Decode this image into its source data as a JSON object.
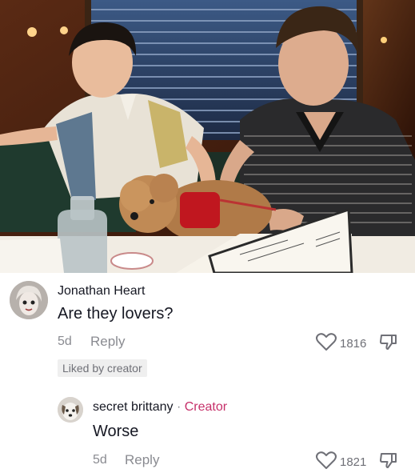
{
  "post": {
    "image_icon": "photo-two-men-with-dog-at-restaurant"
  },
  "comments": [
    {
      "username": "Jonathan Heart",
      "text": "Are they lovers?",
      "age": "5d",
      "reply_label": "Reply",
      "likes": "1816",
      "liked_by_creator": "Liked by creator",
      "like_icon": "heart-outline-icon",
      "dislike_icon": "thumbs-down-icon"
    }
  ],
  "reply": {
    "username": "secret brittany",
    "separator": "·",
    "creator_tag": "Creator",
    "text": "Worse",
    "age": "5d",
    "reply_label": "Reply",
    "likes": "1821",
    "like_icon": "heart-outline-icon",
    "dislike_icon": "thumbs-down-icon"
  },
  "colors": {
    "creator_accent": "#c6306a",
    "meta_gray": "#8a8b91",
    "text_dark": "#161823"
  }
}
